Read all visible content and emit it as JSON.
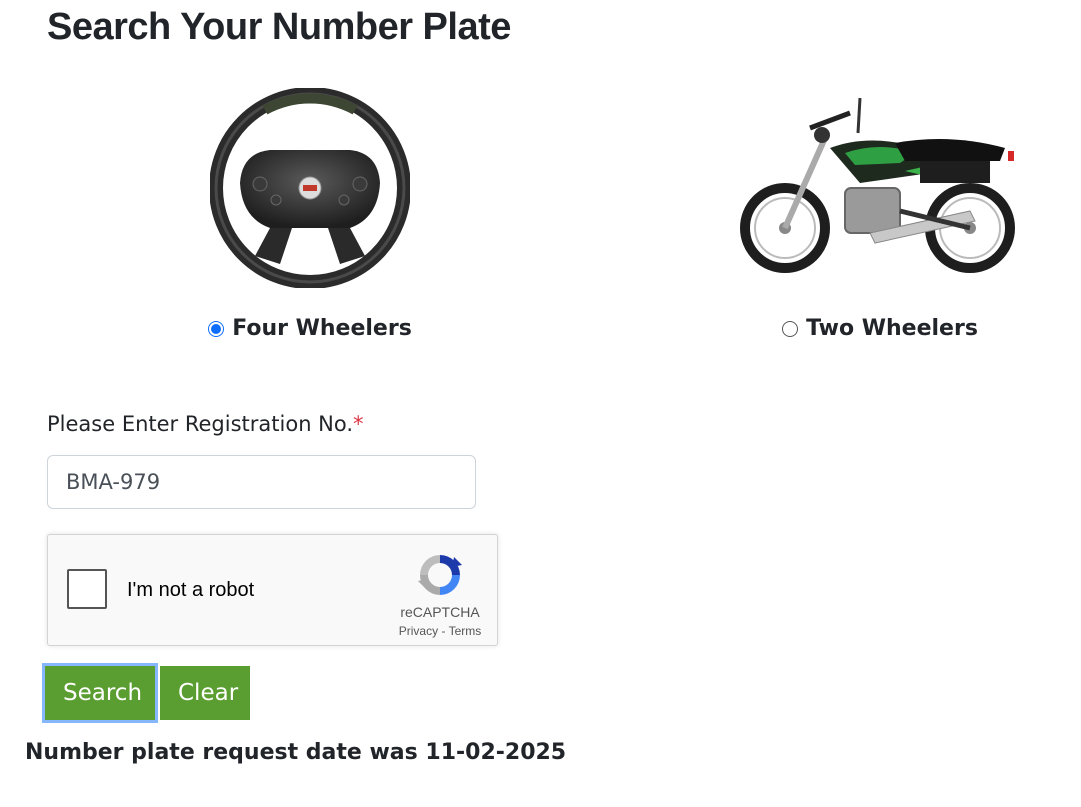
{
  "page": {
    "title": "Search Your Number Plate"
  },
  "vehicle_types": {
    "four_wheelers": {
      "label": "Four Wheelers",
      "icon": "steering-wheel-icon",
      "selected": true
    },
    "two_wheelers": {
      "label": "Two Wheelers",
      "icon": "motorcycle-icon",
      "selected": false
    }
  },
  "form": {
    "label": "Please Enter Registration No.",
    "required_marker": "*",
    "registration_value": "BMA-979"
  },
  "recaptcha": {
    "checkbox_label": "I'm not a robot",
    "brand": "reCAPTCHA",
    "privacy": "Privacy",
    "separator": " - ",
    "terms": "Terms"
  },
  "buttons": {
    "search": "Search",
    "clear": "Clear"
  },
  "status": {
    "message": "Number plate request date was 11-02-2025"
  },
  "colors": {
    "button_green": "#5a9e31",
    "radio_blue": "#0d6efd",
    "required_red": "#dc3545",
    "focus_ring": "#86b7fe"
  }
}
